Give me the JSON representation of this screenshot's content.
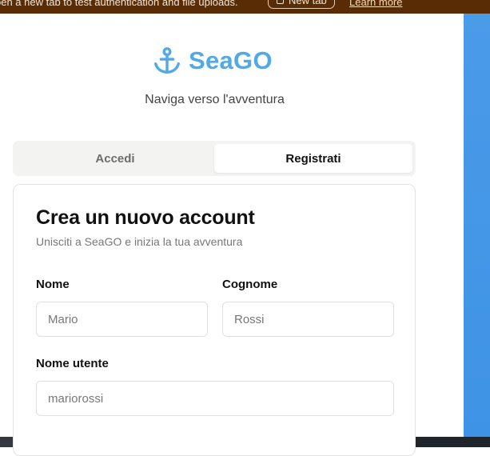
{
  "banner": {
    "message": "pen a new tab to test authentication and file uploads.",
    "new_tab_label": "New tab",
    "learn_more_label": "Learn more"
  },
  "brand": {
    "name": "SeaGO",
    "icon": "anchor-icon",
    "color": "#53a8e6",
    "tagline": "Naviga verso l'avventura"
  },
  "auth_tabs": {
    "login_label": "Accedi",
    "register_label": "Registrati",
    "active": "register"
  },
  "form": {
    "title": "Crea un nuovo account",
    "subtitle": "Unisciti a SeaGO e inizia la tua avventura",
    "first_name": {
      "label": "Nome",
      "placeholder": "Mario"
    },
    "last_name": {
      "label": "Cognome",
      "placeholder": "Rossi"
    },
    "username": {
      "label": "Nome utente",
      "placeholder": "mariorossi"
    }
  },
  "colors": {
    "banner_bg": "#5a2c05",
    "side_panel": "#4a9be8",
    "accent": "#53a8e6"
  }
}
